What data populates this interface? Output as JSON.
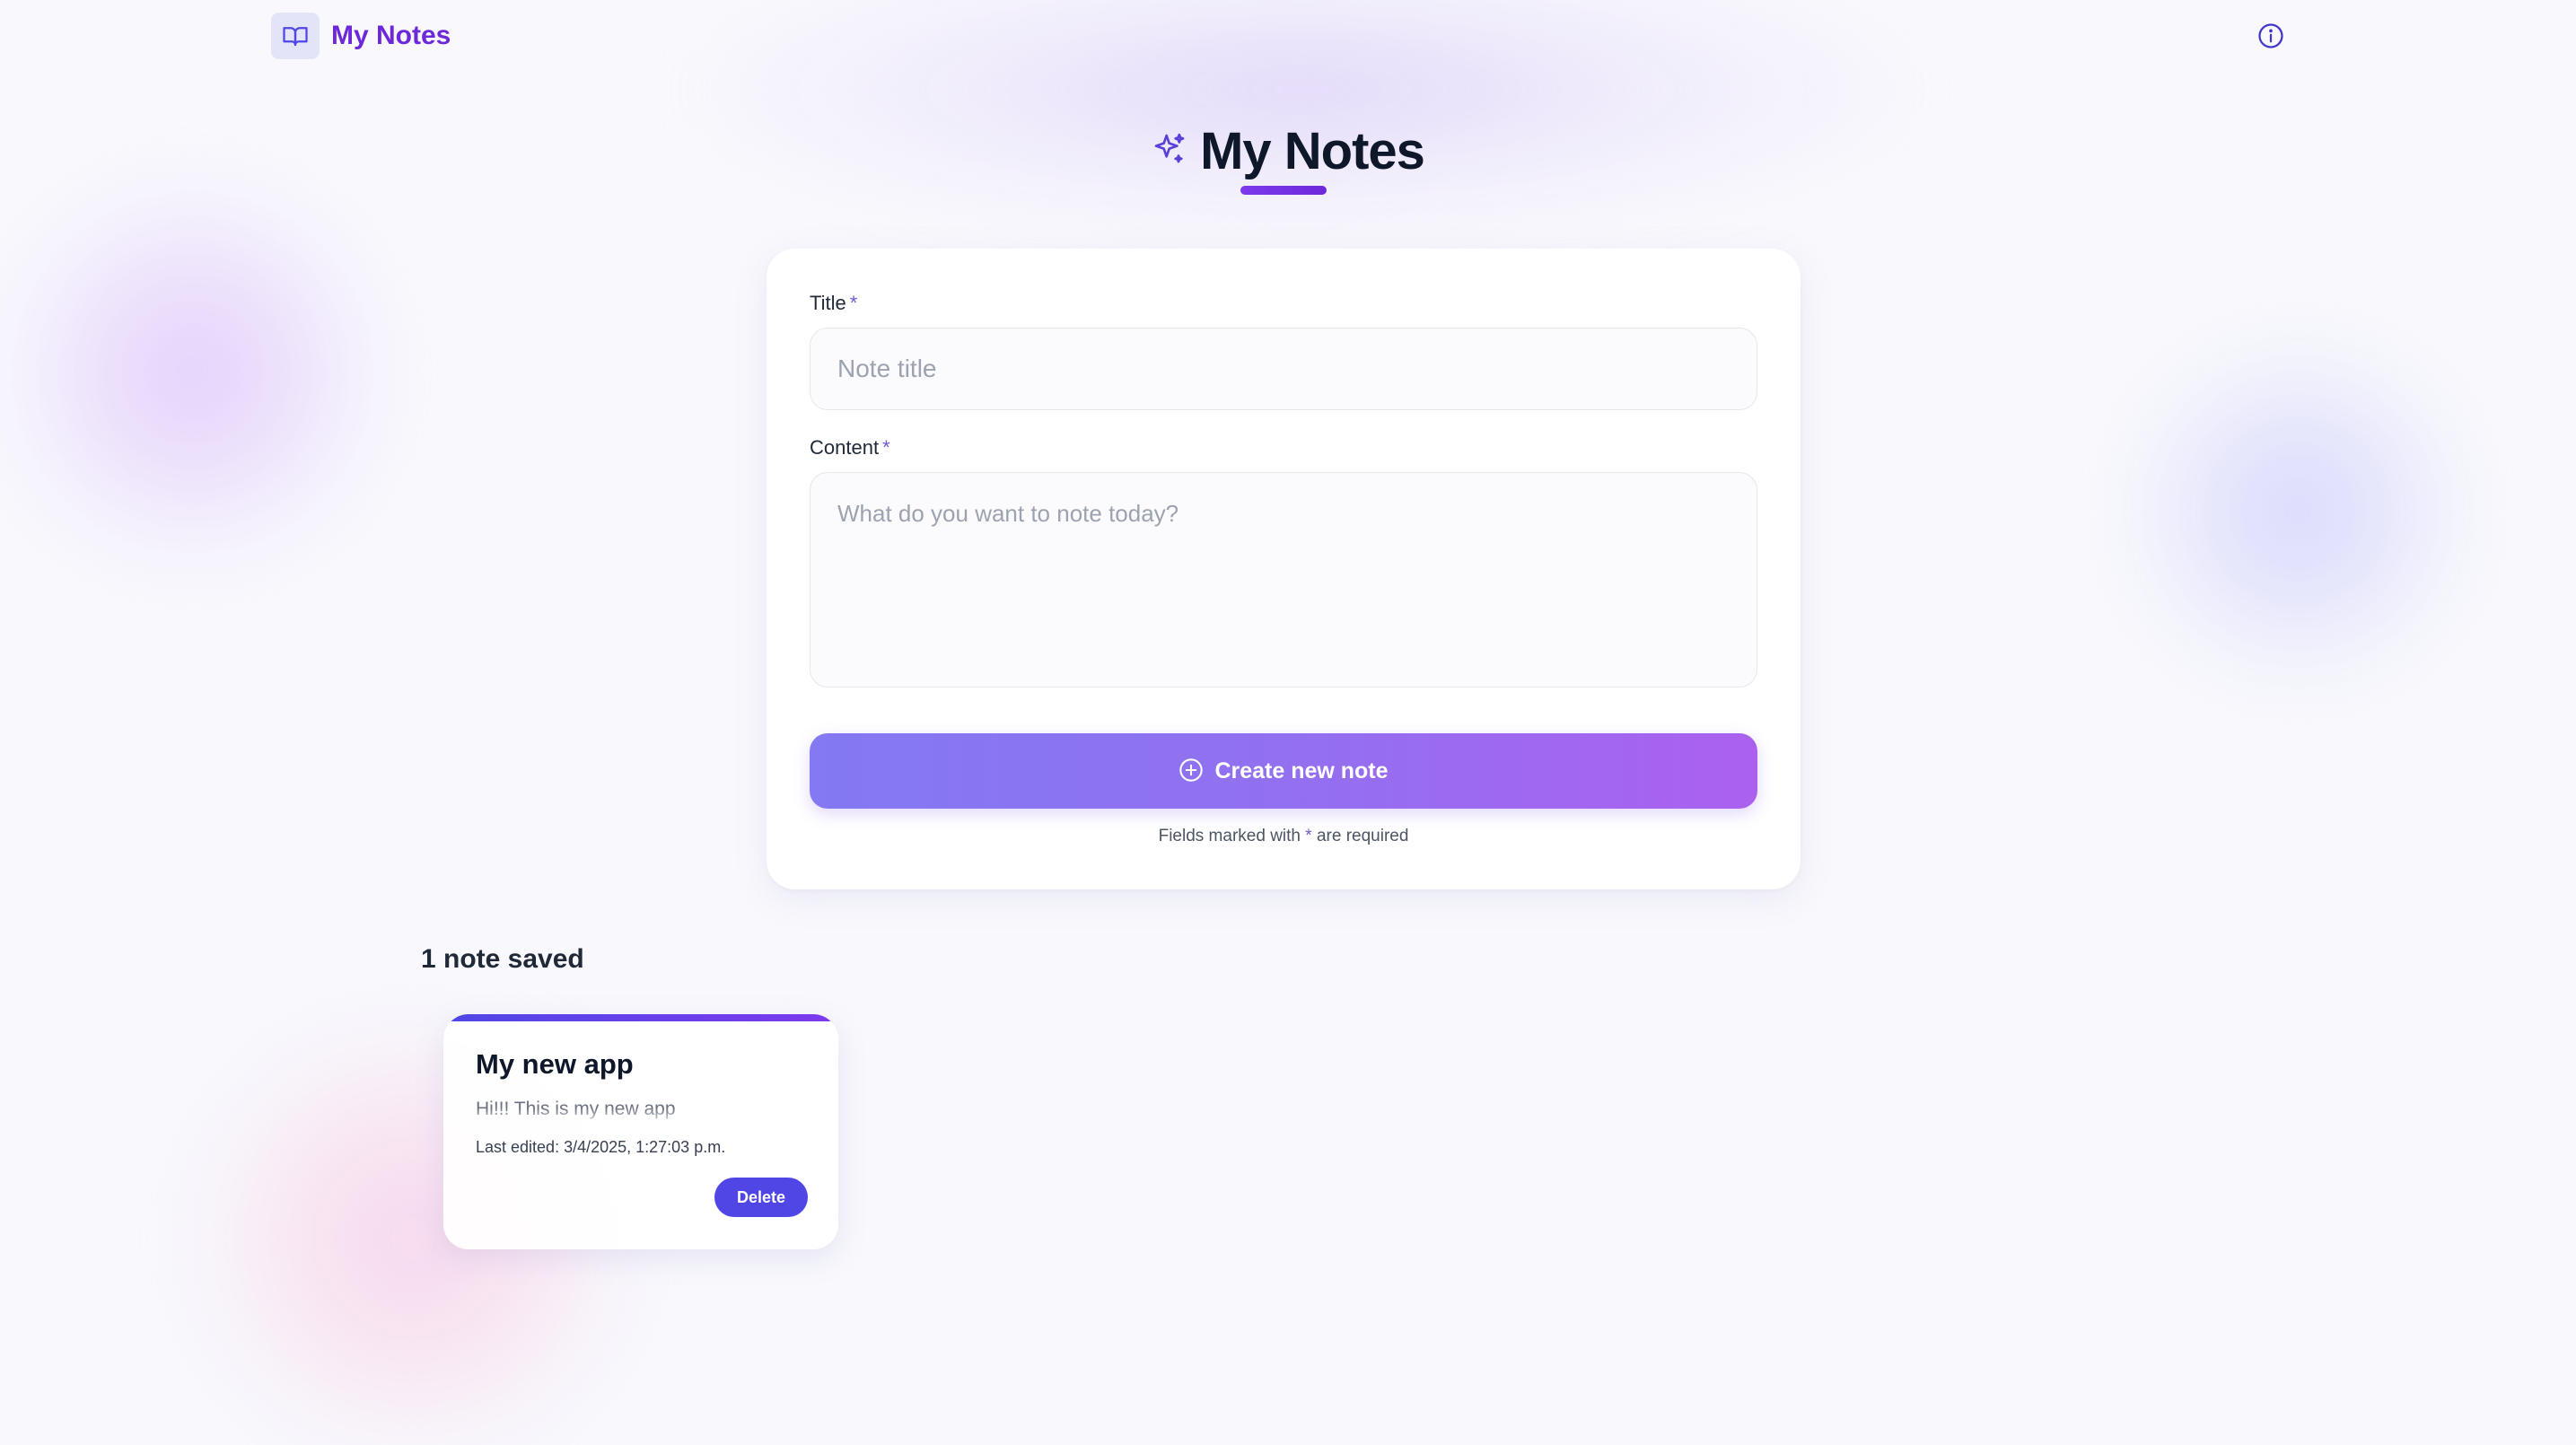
{
  "header": {
    "brand": "My Notes",
    "logo_icon": "book-open-icon",
    "info_icon": "info-circle-icon"
  },
  "page": {
    "title": "My Notes",
    "title_icon": "sparkles-icon"
  },
  "form": {
    "title_label": "Title",
    "title_required": "*",
    "title_placeholder": "Note title",
    "title_value": "",
    "content_label": "Content",
    "content_required": "*",
    "content_placeholder": "What do you want to note today?",
    "content_value": "",
    "create_label": "Create new note",
    "create_icon": "plus-circle-icon",
    "hint_prefix": "Fields marked with",
    "hint_star": "*",
    "hint_suffix": "are required"
  },
  "notes": {
    "count_label": "1 note saved",
    "items": [
      {
        "title": "My new app",
        "body": "Hi!!! This is my new app",
        "edited": "Last edited: 3/4/2025, 1:27:03 p.m.",
        "delete_label": "Delete"
      }
    ]
  },
  "colors": {
    "accent": "#6d28d9",
    "button_gradient_start": "#8379f2",
    "button_gradient_end": "#ab61ee",
    "delete_button": "#4f46e5",
    "background": "#f8f8fd"
  }
}
